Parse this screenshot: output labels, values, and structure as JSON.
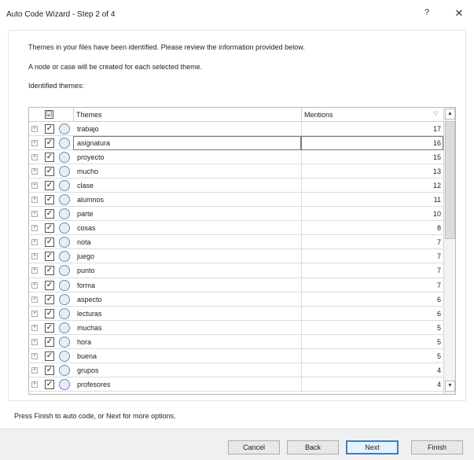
{
  "window": {
    "title": "Auto Code Wizard - Step 2 of 4",
    "help_icon": "?",
    "close_icon": "✕"
  },
  "intro": {
    "line1": "Themes in your files have been identified. Please review the information provided below.",
    "line2": "A node or case will be created for each selected theme.",
    "identified": "Identified themes:"
  },
  "grid": {
    "header_check": "☑",
    "header_themes": "Themes",
    "header_mentions": "Mentions",
    "sort_icon": "▽",
    "selected_index": 1,
    "rows": [
      {
        "theme": "trabajo",
        "mentions": "17"
      },
      {
        "theme": "asignatura",
        "mentions": "16"
      },
      {
        "theme": "proyecto",
        "mentions": "15"
      },
      {
        "theme": "mucho",
        "mentions": "13"
      },
      {
        "theme": "clase",
        "mentions": "12"
      },
      {
        "theme": "alumnos",
        "mentions": "11"
      },
      {
        "theme": "parte",
        "mentions": "10"
      },
      {
        "theme": "cosas",
        "mentions": "8"
      },
      {
        "theme": "nota",
        "mentions": "7"
      },
      {
        "theme": "juego",
        "mentions": "7"
      },
      {
        "theme": "punto",
        "mentions": "7"
      },
      {
        "theme": "forma",
        "mentions": "7"
      },
      {
        "theme": "aspecto",
        "mentions": "6"
      },
      {
        "theme": "lecturas",
        "mentions": "6"
      },
      {
        "theme": "muchas",
        "mentions": "5"
      },
      {
        "theme": "hora",
        "mentions": "5"
      },
      {
        "theme": "buena",
        "mentions": "5"
      },
      {
        "theme": "grupos",
        "mentions": "4"
      },
      {
        "theme": "profesores",
        "mentions": "4"
      }
    ]
  },
  "footer": {
    "instruction": "Press Finish to auto code, or Next for more options.",
    "cancel": "Cancel",
    "back": "Back",
    "next": "Next",
    "finish": "Finish"
  }
}
